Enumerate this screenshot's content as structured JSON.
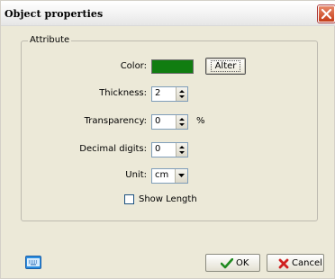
{
  "window": {
    "title": "Object properties"
  },
  "group": {
    "label": "Attribute"
  },
  "fields": {
    "color_label": "Color:",
    "color_value": "#117d11",
    "alter_label": "Alter",
    "thickness_label": "Thickness:",
    "thickness_value": "2",
    "transparency_label": "Transparency:",
    "transparency_value": "0",
    "transparency_unit": "%",
    "decimal_label": "Decimal digits:",
    "decimal_value": "0",
    "unit_label": "Unit:",
    "unit_value": "cm",
    "show_length_label": "Show Length",
    "show_length_checked": false
  },
  "buttons": {
    "ok_label": "OK",
    "cancel_label": "Cancel"
  },
  "icons": {
    "close": "close-icon",
    "keyboard": "keyboard-icon",
    "ok": "check-icon",
    "cancel": "x-icon"
  }
}
